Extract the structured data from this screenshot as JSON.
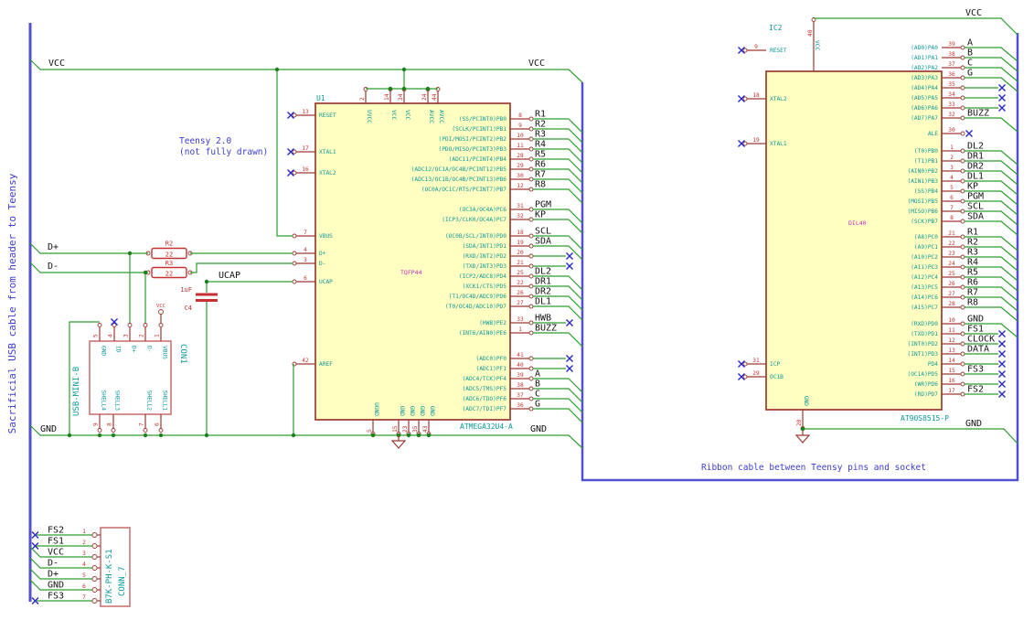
{
  "notes": {
    "left_vertical": "Sacrificial USB cable from header to Teensy",
    "teensy_line1": "Teensy 2.0",
    "teensy_line2": "(not fully drawn)",
    "ribbon": "Ribbon cable between Teensy pins and socket"
  },
  "labels": {
    "vcc": "VCC",
    "gnd": "GND",
    "dplus": "D+",
    "dminus": "D-",
    "ucap": "UCAP"
  },
  "parts": {
    "r2": {
      "ref": "R2",
      "value": "22"
    },
    "r3": {
      "ref": "R3",
      "value": "22"
    },
    "c4": {
      "ref": "C4",
      "value": "1uF"
    }
  },
  "u1": {
    "ref": "U1",
    "part": "ATMEGA32U4-A",
    "footprint": "TQFP44",
    "top_pins": [
      {
        "num": "2",
        "name": "UVCC"
      },
      {
        "num": "14",
        "name": "VCC"
      },
      {
        "num": "34",
        "name": "VCC"
      },
      {
        "num": "24",
        "name": "AVCC"
      },
      {
        "num": "44",
        "name": "AVCC"
      }
    ],
    "bottom_pins": [
      {
        "num": "5",
        "name": "UGND"
      },
      {
        "num": "15",
        "name": "GND"
      },
      {
        "num": "23",
        "name": "GND"
      },
      {
        "num": "35",
        "name": "GND"
      },
      {
        "num": "43",
        "name": "GND"
      }
    ],
    "left_pins": [
      {
        "num": "13",
        "name": "RESET",
        "term": "nc"
      },
      {
        "num": "17",
        "name": "XTAL1",
        "term": "nc"
      },
      {
        "num": "16",
        "name": "XTAL2",
        "term": "nc"
      },
      {
        "num": "7",
        "name": "VBUS",
        "term": "wire"
      },
      {
        "num": "4",
        "name": "D+",
        "term": "wire"
      },
      {
        "num": "3",
        "name": "D-",
        "term": "wire"
      },
      {
        "num": "6",
        "name": "UCAP",
        "term": "wire"
      },
      {
        "num": "42",
        "name": "AREF",
        "term": "wire"
      }
    ],
    "right_pins": [
      {
        "num": "8",
        "name": "(SS/PCINT0)PB0",
        "net": "R1",
        "term": "bus"
      },
      {
        "num": "9",
        "name": "(SCLK/PCINT1)PB1",
        "net": "R2",
        "term": "bus"
      },
      {
        "num": "10",
        "name": "(PDI/MOSI/PCINT2)PB2",
        "net": "R3",
        "term": "bus"
      },
      {
        "num": "11",
        "name": "(PDO/MISO/PCINT3)PB3",
        "net": "R4",
        "term": "bus"
      },
      {
        "num": "28",
        "name": "(ADC11/PCINT4)PB4",
        "net": "R5",
        "term": "bus"
      },
      {
        "num": "29",
        "name": "(ADC12/OC1A/OC4B/PCINT12)PB5",
        "net": "R6",
        "term": "bus"
      },
      {
        "num": "30",
        "name": "(ADC13/OC1B/OC4B/PCINT13)PB6",
        "net": "R7",
        "term": "bus"
      },
      {
        "num": "12",
        "name": "(OC0A/OC1C/RTS/PCINT7)PB7",
        "net": "R8",
        "term": "bus"
      },
      {
        "num": "31",
        "name": "(OC3A/OC4A)PC6",
        "net": "PGM",
        "term": "bus"
      },
      {
        "num": "32",
        "name": "(ICP3/CLK0/OC4A)PC7",
        "net": "KP",
        "term": "bus"
      },
      {
        "num": "18",
        "name": "(OC0B/SCL/INT0)PD0",
        "net": "SCL",
        "term": "bus"
      },
      {
        "num": "19",
        "name": "(SDA/INT1)PD1",
        "net": "SDA",
        "term": "bus"
      },
      {
        "num": "20",
        "name": "(RXD/INT2)PD2",
        "net": "",
        "term": "nc"
      },
      {
        "num": "21",
        "name": "(TXD/INT3)PD3",
        "net": "",
        "term": "nc"
      },
      {
        "num": "25",
        "name": "(ICP2/ADC8)PD4",
        "net": "DL2",
        "term": "bus"
      },
      {
        "num": "22",
        "name": "(XCK1/CTS)PD5",
        "net": "DR1",
        "term": "bus"
      },
      {
        "num": "26",
        "name": "(T1/OC4D/ADC9)PD6",
        "net": "DR2",
        "term": "bus"
      },
      {
        "num": "27",
        "name": "(T0/OC4D/ADC10)PD7",
        "net": "DL1",
        "term": "bus"
      },
      {
        "num": "33",
        "name": "(HWB)PE2",
        "net": "HWB",
        "term": "nc"
      },
      {
        "num": "1",
        "name": "(INT6/AIN0)PE6",
        "net": "BUZZ",
        "term": "bus"
      },
      {
        "num": "41",
        "name": "(ADC0)PF0",
        "net": "",
        "term": "nc"
      },
      {
        "num": "40",
        "name": "(ADC1)PF1",
        "net": "",
        "term": "nc"
      },
      {
        "num": "39",
        "name": "(ADC4/TCK)PF4",
        "net": "A",
        "term": "bus"
      },
      {
        "num": "38",
        "name": "(ADC5/TMS)PF5",
        "net": "B",
        "term": "bus"
      },
      {
        "num": "37",
        "name": "(ADC6/TDO)PF6",
        "net": "C",
        "term": "bus"
      },
      {
        "num": "36",
        "name": "(ADC7/TDI)PF7",
        "net": "G",
        "term": "bus"
      }
    ]
  },
  "ic2": {
    "ref": "IC2",
    "part": "AT90S8515-P",
    "footprint": "DIL40",
    "top_pins": [
      {
        "num": "40",
        "name": "VCC"
      }
    ],
    "bottom_pins": [
      {
        "num": "20",
        "name": "GND"
      }
    ],
    "left_pins": [
      {
        "num": "9",
        "name": "RESET",
        "term": "nc"
      },
      {
        "num": "18",
        "name": "XTAL2",
        "term": "nc"
      },
      {
        "num": "19",
        "name": "XTAL1",
        "term": "nc"
      },
      {
        "num": "31",
        "name": "ICP",
        "term": "nc"
      },
      {
        "num": "29",
        "name": "OC1B",
        "term": "nc"
      }
    ],
    "right_pins": [
      {
        "num": "39",
        "name": "(AD0)PA0",
        "net": "A",
        "term": "bus"
      },
      {
        "num": "38",
        "name": "(AD1)PA1",
        "net": "B",
        "term": "bus"
      },
      {
        "num": "37",
        "name": "(AD2)PA2",
        "net": "C",
        "term": "bus"
      },
      {
        "num": "36",
        "name": "(AD3)PA3",
        "net": "G",
        "term": "bus"
      },
      {
        "num": "35",
        "name": "(AD4)PA4",
        "net": "",
        "term": "nc"
      },
      {
        "num": "34",
        "name": "(AD5)PA5",
        "net": "",
        "term": "nc"
      },
      {
        "num": "33",
        "name": "(AD6)PA6",
        "net": "",
        "term": "nc"
      },
      {
        "num": "32",
        "name": "(AD7)PA7",
        "net": "BUZZ",
        "term": "bus"
      },
      {
        "num": "30",
        "name": "ALE",
        "net": "",
        "term": "ncshort"
      },
      {
        "num": "1",
        "name": "(T0)PB0",
        "net": "DL2",
        "term": "bus"
      },
      {
        "num": "2",
        "name": "(T1)PB1",
        "net": "DR1",
        "term": "bus"
      },
      {
        "num": "3",
        "name": "(AIN0)PB2",
        "net": "DR2",
        "term": "bus"
      },
      {
        "num": "4",
        "name": "(AIN1)PB3",
        "net": "DL1",
        "term": "bus"
      },
      {
        "num": "5",
        "name": "(SS)PB4",
        "net": "KP",
        "term": "bus"
      },
      {
        "num": "6",
        "name": "(MOSI)PB5",
        "net": "PGM",
        "term": "bus"
      },
      {
        "num": "7",
        "name": "(MISO)PB6",
        "net": "SCL",
        "term": "bus"
      },
      {
        "num": "8",
        "name": "(SCK)PB7",
        "net": "SDA",
        "term": "bus"
      },
      {
        "num": "21",
        "name": "(A8)PC0",
        "net": "R1",
        "term": "bus"
      },
      {
        "num": "22",
        "name": "(A9)PC1",
        "net": "R2",
        "term": "bus"
      },
      {
        "num": "23",
        "name": "(A10)PC2",
        "net": "R3",
        "term": "bus"
      },
      {
        "num": "24",
        "name": "(A11)PC3",
        "net": "R4",
        "term": "bus"
      },
      {
        "num": "25",
        "name": "(A12)PC4",
        "net": "R5",
        "term": "bus"
      },
      {
        "num": "26",
        "name": "(A13)PC5",
        "net": "R6",
        "term": "bus"
      },
      {
        "num": "27",
        "name": "(A14)PC6",
        "net": "R7",
        "term": "bus"
      },
      {
        "num": "28",
        "name": "(A15)PC7",
        "net": "R8",
        "term": "bus"
      },
      {
        "num": "10",
        "name": "(RXD)PD0",
        "net": "GND",
        "term": "bus"
      },
      {
        "num": "11",
        "name": "(TXD)PD1",
        "net": "FS1",
        "term": "nc"
      },
      {
        "num": "12",
        "name": "(INT0)PD2",
        "net": "CLOCK",
        "term": "nc"
      },
      {
        "num": "13",
        "name": "(INT1)PD3",
        "net": "DATA",
        "term": "nc"
      },
      {
        "num": "14",
        "name": "PD4",
        "net": "",
        "term": "nc"
      },
      {
        "num": "15",
        "name": "(OC1A)PD5",
        "net": "FS3",
        "term": "nc"
      },
      {
        "num": "16",
        "name": "(WR)PD6",
        "net": "",
        "term": "nc"
      },
      {
        "num": "17",
        "name": "(RD)PD7",
        "net": "FS2",
        "term": "nc"
      }
    ]
  },
  "con1": {
    "ref": "CON1",
    "part": "USB-MINI-B",
    "top_pins": [
      {
        "num": "5",
        "name": "GND",
        "term": "wire"
      },
      {
        "num": "4",
        "name": "ID",
        "term": "nc"
      },
      {
        "num": "3",
        "name": "D+",
        "term": "wire"
      },
      {
        "num": "2",
        "name": "D-",
        "term": "wire"
      },
      {
        "num": "1",
        "name": "VBUS",
        "term": "power"
      }
    ],
    "bottom_pins": [
      {
        "num": "9",
        "name": "SHELL4"
      },
      {
        "num": "8",
        "name": "SHELL3"
      },
      {
        "num": "7",
        "name": "SHELL2"
      },
      {
        "num": "6",
        "name": "SHELL1"
      }
    ]
  },
  "conn7": {
    "ref": "CONN_7",
    "part": "B7K-PH-K-S1",
    "pins": [
      {
        "num": "1",
        "net": "FS2",
        "term": "nc"
      },
      {
        "num": "2",
        "net": "FS1",
        "term": "nc"
      },
      {
        "num": "3",
        "net": "VCC",
        "term": "bus"
      },
      {
        "num": "4",
        "net": "D-",
        "term": "bus"
      },
      {
        "num": "5",
        "net": "D+",
        "term": "bus"
      },
      {
        "num": "6",
        "net": "GND",
        "term": "bus"
      },
      {
        "num": "7",
        "net": "FS3",
        "term": "nc"
      }
    ]
  },
  "colors": {
    "wire": "#2f9e2f",
    "junction": "#1d811d",
    "outline": "#9c3a32",
    "pinnum": "#c53030",
    "cyan": "#0d9898",
    "icfill": "#ffffc2",
    "black": "#141414",
    "note": "#3c3ccd",
    "bus": "#5050d0",
    "nc": "#2626c6",
    "magenta": "#c12fc1",
    "conn": "#c96a6a"
  }
}
